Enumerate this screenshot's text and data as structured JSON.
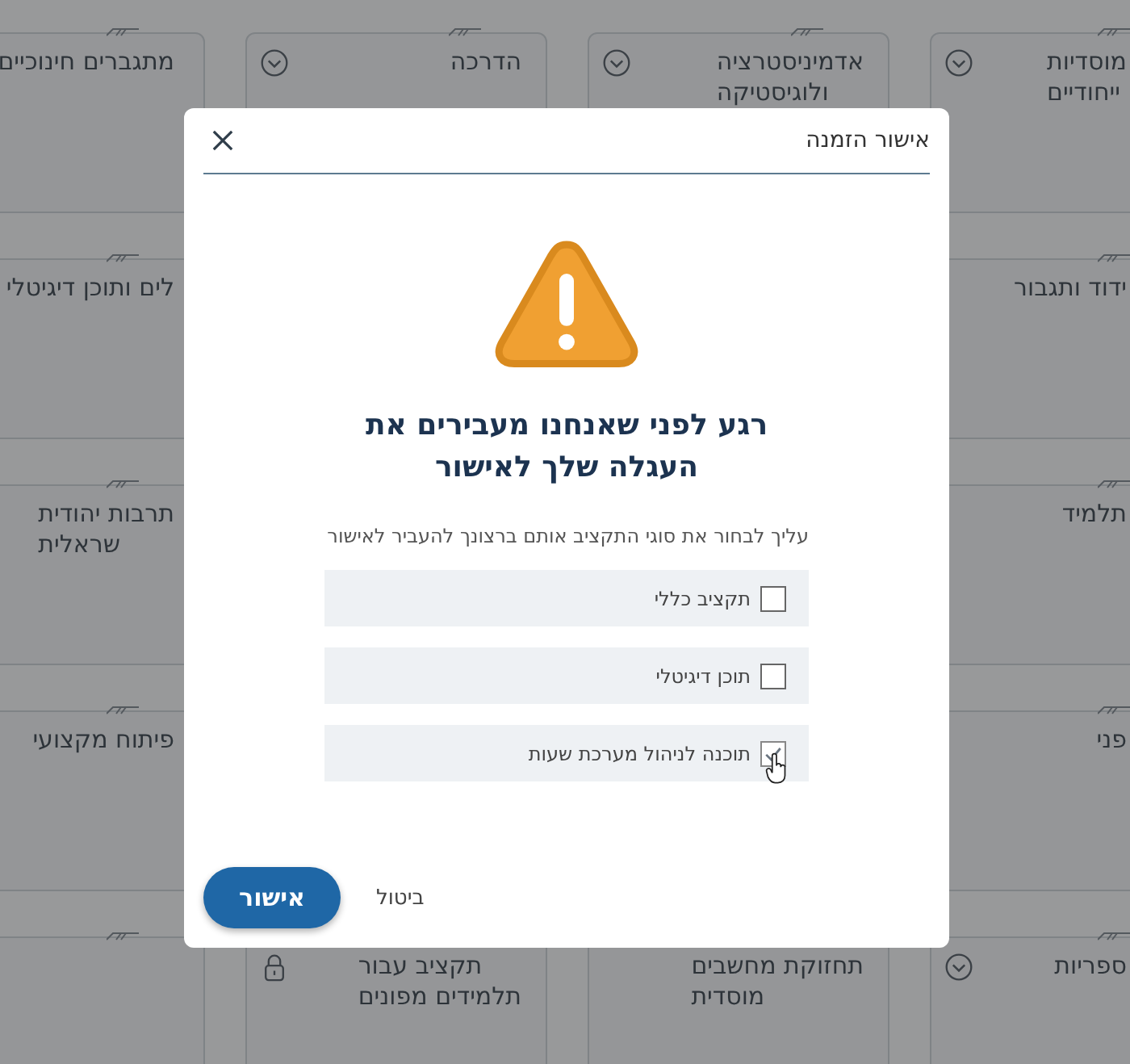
{
  "tiles": [
    {
      "cells": [
        {
          "kind": "expandable",
          "lines": [
            "מוסדיות",
            "ייחודיים"
          ]
        },
        {
          "kind": "expandable",
          "lines": [
            "אדמיניסטרציה",
            "ולוגיסטיקה"
          ]
        },
        {
          "kind": "expandable",
          "lines": [
            "הדרכה"
          ]
        },
        {
          "kind": "plain",
          "lines": [
            "מתגברים חינוכיים"
          ]
        }
      ]
    },
    {
      "cells": [
        {
          "kind": "plain",
          "lines": [
            "ידוד ותגבור"
          ]
        },
        {
          "kind": "plain",
          "lines": [
            "לים ותוכן דיגיטלי"
          ]
        }
      ]
    },
    {
      "cells": [
        {
          "kind": "plain",
          "lines": [
            "תלמיד"
          ]
        },
        {
          "kind": "plain",
          "lines": [
            "תרבות יהודית",
            "שראלית"
          ]
        }
      ]
    },
    {
      "cells": [
        {
          "kind": "plain",
          "lines": [
            "פני"
          ]
        },
        {
          "kind": "plain",
          "lines": [
            "פיתוח מקצועי"
          ]
        }
      ]
    },
    {
      "cells": [
        {
          "kind": "expandable",
          "lines": [
            "ספריות"
          ]
        },
        {
          "kind": "plain",
          "lines": [
            "תחזוקת מחשבים",
            "מוסדית"
          ]
        },
        {
          "kind": "locked",
          "lines": [
            "תקציב עבור",
            "תלמידים מפונים"
          ]
        },
        {
          "kind": "plain"
        }
      ]
    }
  ],
  "dialog": {
    "title": "אישור הזמנה",
    "heading": "רגע לפני שאנחנו מעבירים את העגלה שלך לאישור",
    "instruction": "עליך לבחור את סוגי התקציב אותם ברצונך להעביר לאישור",
    "options": [
      {
        "label": "תקציב כללי",
        "checked": false
      },
      {
        "label": "תוכן דיגיטלי",
        "checked": false
      },
      {
        "label": "תוכנה לניהול מערכת שעות",
        "checked": true
      }
    ],
    "confirm": "אישור",
    "cancel": "ביטול"
  }
}
